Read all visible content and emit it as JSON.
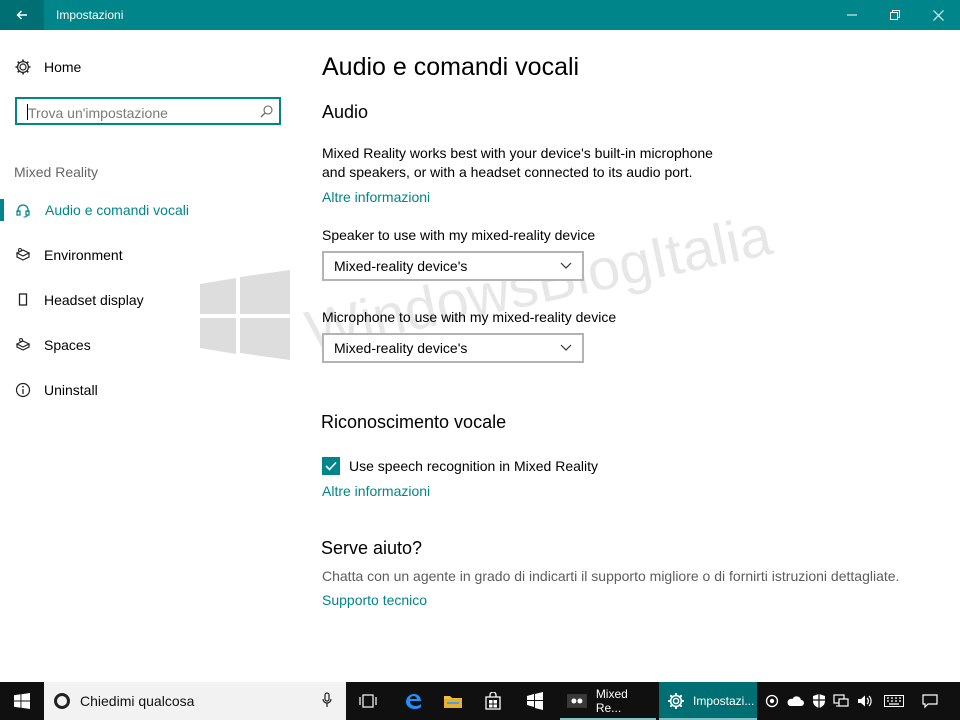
{
  "window": {
    "title": "Impostazioni",
    "accent": "#00858a"
  },
  "sidebar": {
    "home_label": "Home",
    "search_placeholder": "Trova un'impostazione",
    "section_label": "Mixed Reality",
    "items": [
      {
        "label": "Audio e comandi vocali",
        "icon": "headset-icon",
        "active": true
      },
      {
        "label": "Environment",
        "icon": "environment-icon",
        "active": false
      },
      {
        "label": "Headset display",
        "icon": "headset-display-icon",
        "active": false
      },
      {
        "label": "Spaces",
        "icon": "spaces-icon",
        "active": false
      },
      {
        "label": "Uninstall",
        "icon": "info-icon",
        "active": false
      }
    ]
  },
  "main": {
    "page_title": "Audio e comandi vocali",
    "audio": {
      "heading": "Audio",
      "description_line1": "Mixed Reality works best with your device's built-in microphone",
      "description_line2": "and speakers, or with a headset connected to its audio port.",
      "more_info": "Altre informazioni",
      "speaker_label": "Speaker to use with my mixed-reality device",
      "speaker_value": "Mixed-reality device's",
      "mic_label": "Microphone to use with my mixed-reality device",
      "mic_value": "Mixed-reality device's"
    },
    "speech": {
      "heading": "Riconoscimento vocale",
      "checkbox_label": "Use speech recognition in Mixed Reality",
      "checked": true,
      "more_info": "Altre informazioni"
    },
    "help": {
      "heading": "Serve aiuto?",
      "text": "Chatta con un agente in grado di indicarti il supporto migliore o di fornirti istruzioni dettagliate.",
      "link": "Supporto tecnico"
    }
  },
  "watermark": {
    "text": "WindowsBlogItalia"
  },
  "taskbar": {
    "search_text": "Chiedimi qualcosa",
    "apps": [
      {
        "label": "Mixed Re...",
        "icon": "mixed-reality-icon"
      },
      {
        "label": "Impostazi...",
        "icon": "settings-gear-icon",
        "active": true
      }
    ]
  }
}
